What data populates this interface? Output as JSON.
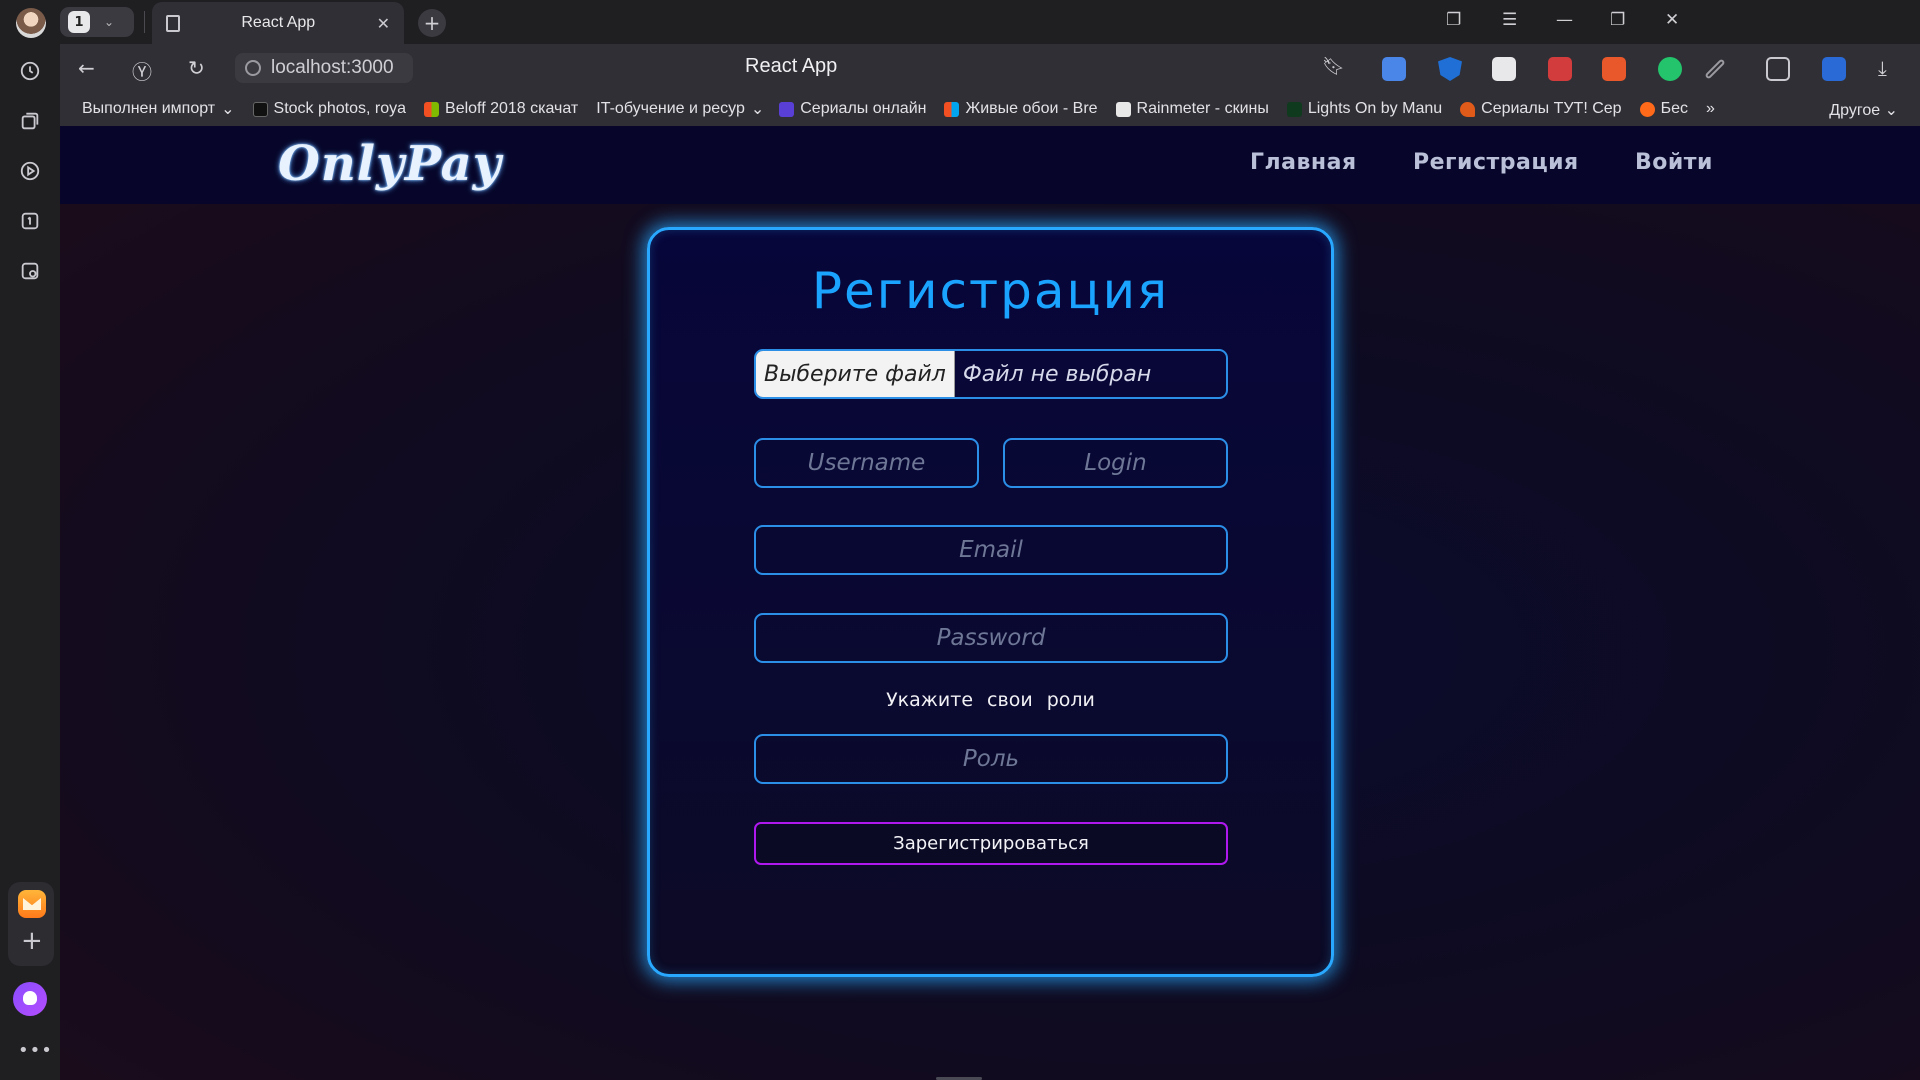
{
  "browser": {
    "tab_count": "1",
    "tab_title": "React App",
    "url": "localhost:3000",
    "page_title": "React App",
    "bookmarks": [
      "Выполнен импорт",
      "Stock photos, roya",
      "Beloff 2018 скачат",
      "IT-обучение и ресур",
      "Сериалы онлайн",
      "Живые обои - Bre",
      "Rainmeter - скины",
      "Lights On by Manu",
      "Сериалы ТУТ! Сер",
      "Бес"
    ],
    "bookmarks_other": "Другое"
  },
  "site": {
    "logo": "OnlyPay",
    "nav": {
      "home": "Главная",
      "register": "Регистрация",
      "login": "Войти"
    }
  },
  "form": {
    "title": "Регистрация",
    "file_button": "Выберите файл",
    "file_status": "Файл не выбран",
    "username_placeholder": "Username",
    "login_placeholder": "Login",
    "email_placeholder": "Email",
    "password_placeholder": "Password",
    "roles_label": "Укажите свои роли",
    "role_placeholder": "Роль",
    "submit_label": "Зарегистрироваться"
  },
  "colors": {
    "accent_blue": "#29a8ff",
    "submit_border": "#b018f0",
    "navbar_bg": "#07062a"
  }
}
